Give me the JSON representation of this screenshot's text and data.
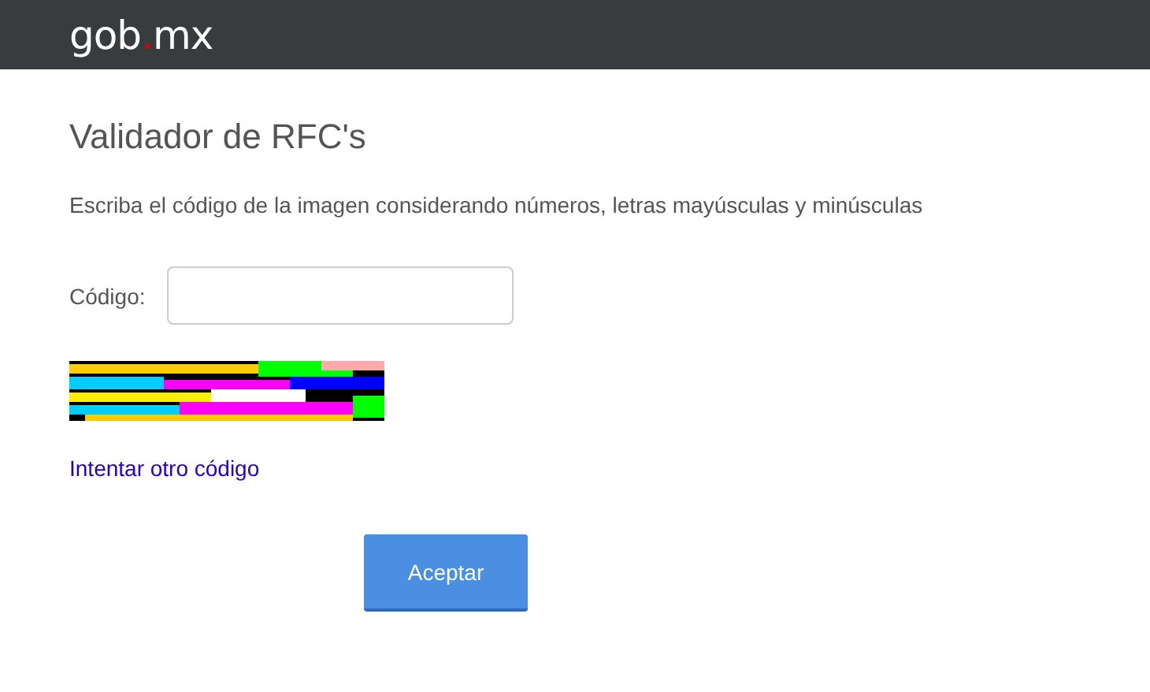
{
  "header": {
    "logo": {
      "name": "gob",
      "dot": ".",
      "tld": "mx"
    }
  },
  "title": "Validador de RFC's",
  "instructions": "Escriba el código de la imagen considerando números, letras mayúsculas y minúsculas",
  "code_field": {
    "label": "Código:"
  },
  "retry_link": "Intentar otro código",
  "submit_button": "Aceptar"
}
